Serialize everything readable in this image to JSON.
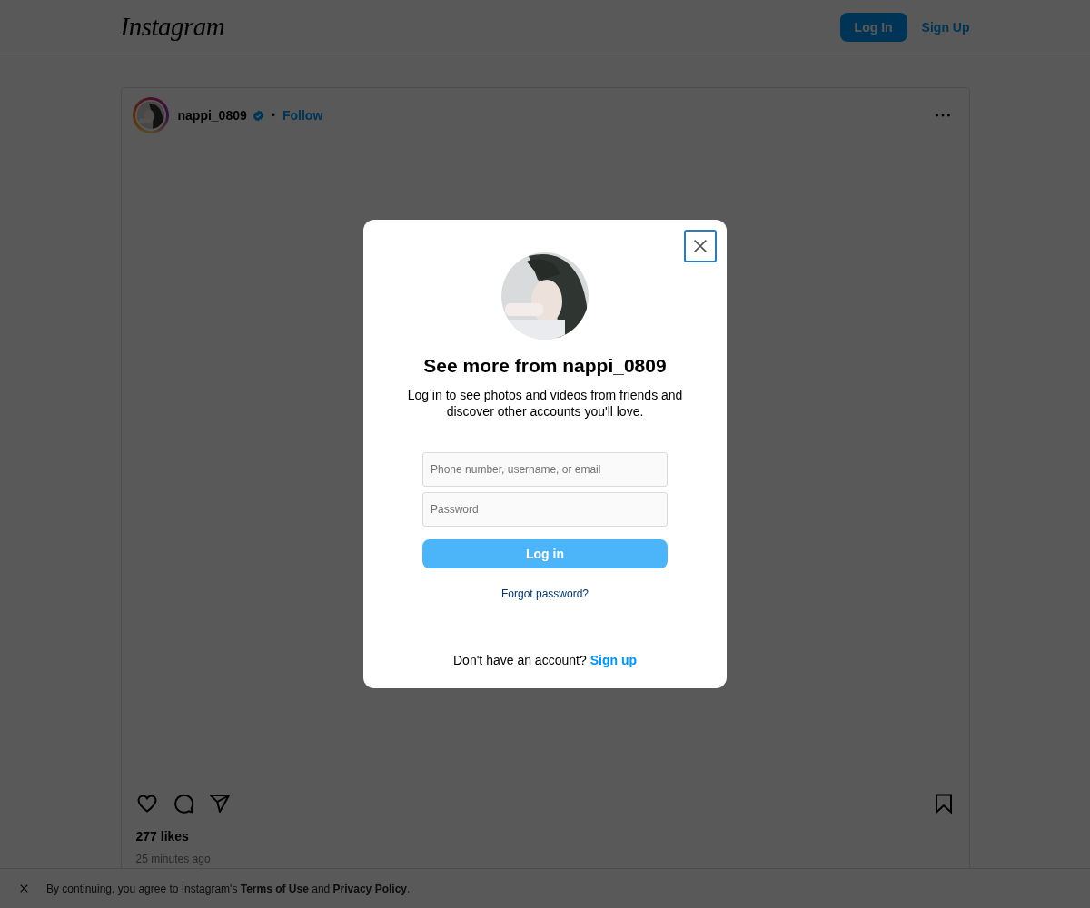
{
  "header": {
    "logo": "Instagram",
    "login_button": "Log In",
    "signup_link": "Sign Up"
  },
  "post": {
    "username": "nappi_0809",
    "verified": true,
    "separator": "•",
    "follow": "Follow",
    "likes": "277 likes",
    "time": "25 minutes ago"
  },
  "modal": {
    "title": "See more from nappi_0809",
    "subtitle": "Log in to see photos and videos from friends and discover other accounts you'll love.",
    "username_field": {
      "placeholder": "Phone number, username, or email"
    },
    "password_field": {
      "placeholder": "Password"
    },
    "login_button": "Log in",
    "forgot_link": "Forgot password?",
    "signup_prompt": "Don't have an account?",
    "signup_link": "Sign up"
  },
  "cookie_bar": {
    "text": "By continuing, you agree to Instagram's **Terms of Use** and **Privacy Policy**."
  }
}
